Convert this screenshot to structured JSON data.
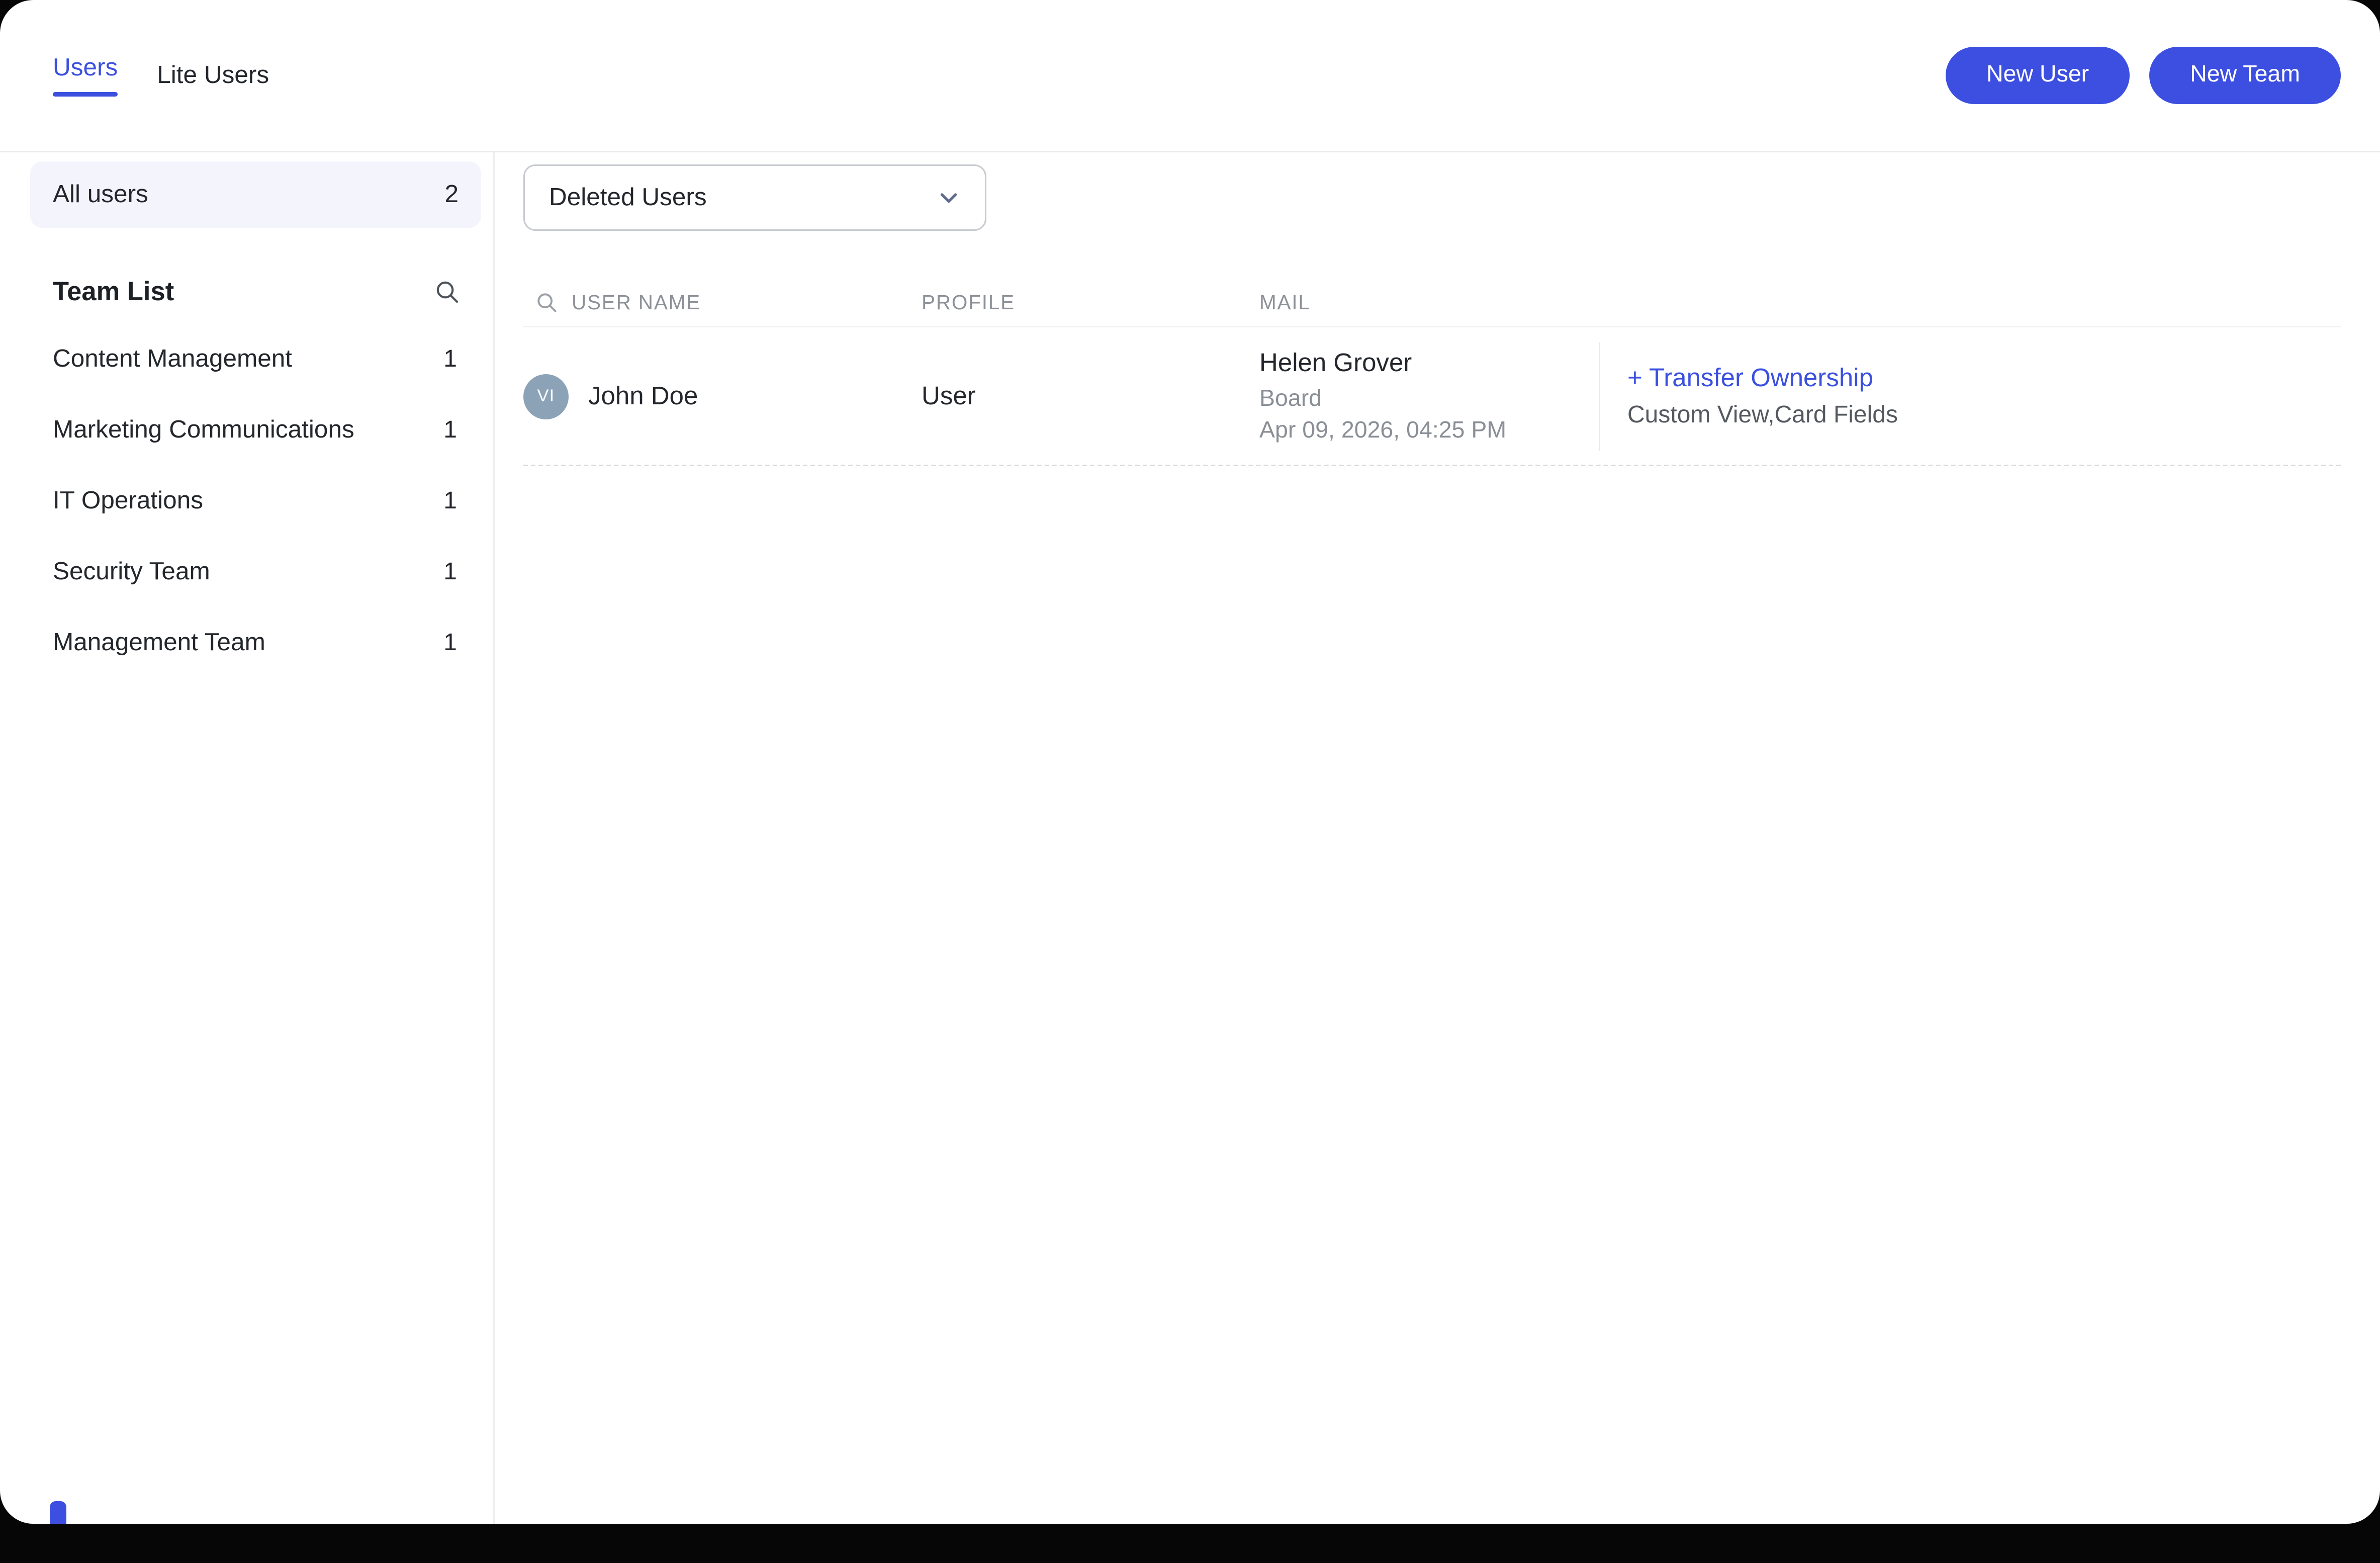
{
  "tabs": [
    {
      "label": "Users"
    },
    {
      "label": "Lite Users"
    }
  ],
  "header_buttons": {
    "new_user": "New User",
    "new_team": "New Team"
  },
  "sidebar": {
    "all_users": {
      "label": "All users",
      "count": "2"
    },
    "team_list_title": "Team List",
    "teams": [
      {
        "name": "Content Management",
        "count": "1"
      },
      {
        "name": "Marketing Communications",
        "count": "1"
      },
      {
        "name": "IT Operations",
        "count": "1"
      },
      {
        "name": "Security Team",
        "count": "1"
      },
      {
        "name": "Management Team",
        "count": "1"
      }
    ]
  },
  "main": {
    "filter_dropdown": {
      "value": "Deleted Users"
    },
    "table": {
      "columns": [
        "USER NAME",
        "PROFILE",
        "MAIL"
      ],
      "rows": [
        {
          "avatar_initials": "VI",
          "user_name": "John Doe",
          "profile": "User",
          "mail_name": "Helen Grover",
          "mail_sub": "Board",
          "mail_date": "Apr 09, 2026, 04:25 PM",
          "action_link": "+ Transfer Ownership",
          "action_sub": "Custom View,Card Fields"
        }
      ]
    }
  },
  "colors": {
    "accent": "#3d4fe0",
    "link": "#3b50df",
    "avatar_bg": "#8ca2b6",
    "selected_row_bg": "#f4f4fd",
    "background": "#060606"
  }
}
